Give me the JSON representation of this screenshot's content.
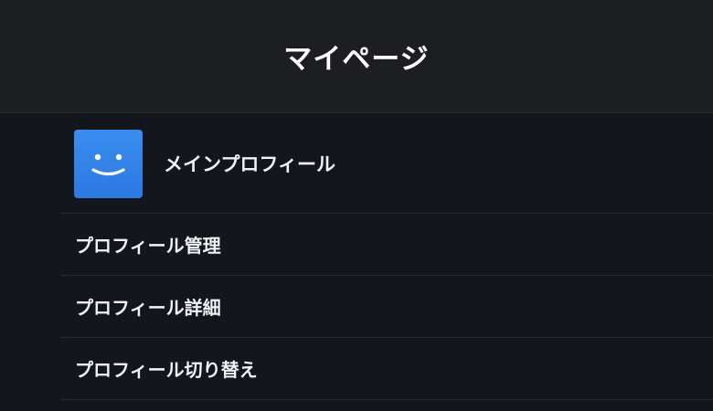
{
  "header": {
    "title": "マイページ"
  },
  "profile": {
    "name": "メインプロフィール",
    "avatar_icon": "smiley-face-icon",
    "avatar_color": "#3a8dee"
  },
  "menu": {
    "items": [
      {
        "label": "プロフィール管理"
      },
      {
        "label": "プロフィール詳細"
      },
      {
        "label": "プロフィール切り替え"
      }
    ]
  },
  "colors": {
    "background": "#14161d",
    "header_background": "#1d1e22",
    "divider": "#2a2c33",
    "text": "#f2f3f5"
  }
}
